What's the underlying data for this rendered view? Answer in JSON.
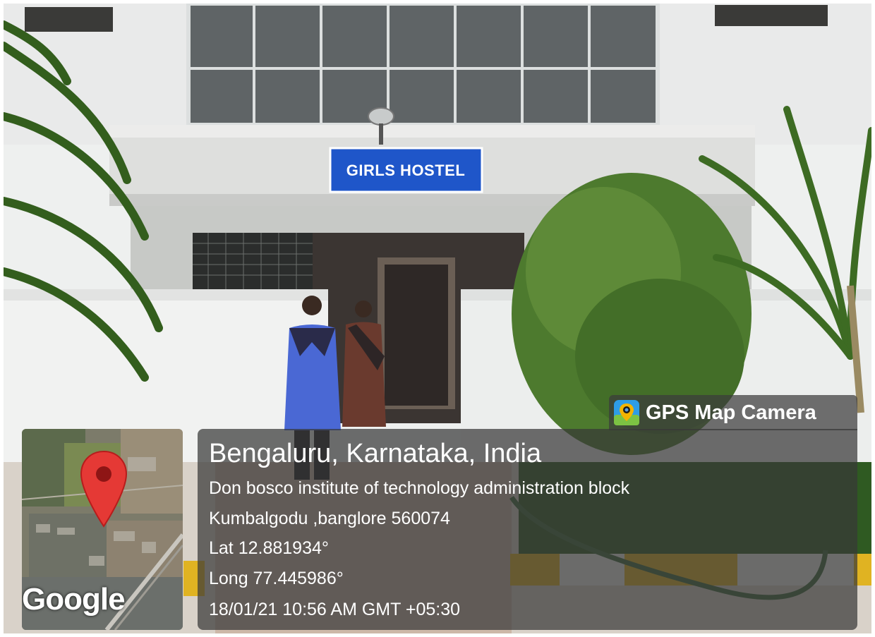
{
  "sign": {
    "text": "GIRLS HOSTEL"
  },
  "overlay": {
    "app_label": "GPS Map Camera",
    "location_title": "Bengaluru, Karnataka, India",
    "address_line1": "Don bosco institute of technology administration block",
    "address_line2": "Kumbalgodu ,banglore 560074",
    "latitude": "Lat 12.881934°",
    "longitude": "Long 77.445986°",
    "datetime": "18/01/21 10:56 AM GMT +05:30",
    "map_provider": "Google"
  },
  "icons": {
    "app_icon": "camera-pin-icon",
    "map_marker": "map-pin-icon"
  },
  "colors": {
    "sign_blue": "#1f56c9",
    "pin_red": "#e53935",
    "overlay_bg": "rgba(55,55,55,0.72)"
  }
}
